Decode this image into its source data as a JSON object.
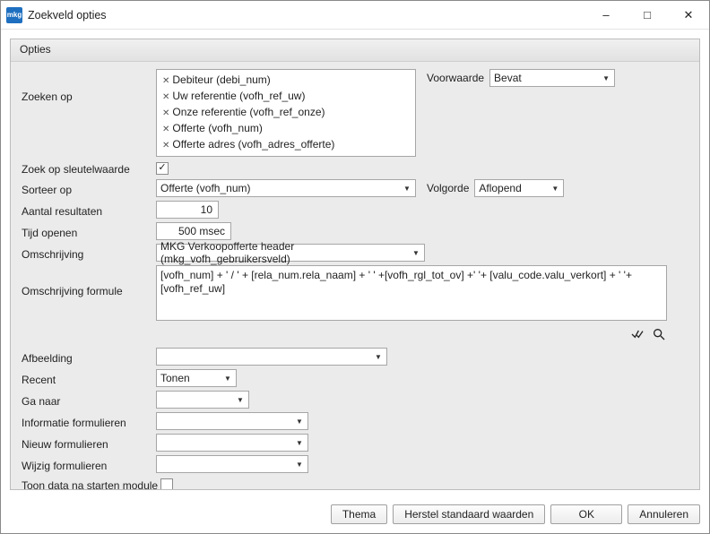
{
  "window": {
    "title": "Zoekveld opties",
    "icon_text": "mkg"
  },
  "groupbox": {
    "title": "Opties"
  },
  "labels": {
    "zoeken_op": "Zoeken op",
    "voorwaarde": "Voorwaarde",
    "zoek_sleutel": "Zoek op sleutelwaarde",
    "sorteer_op": "Sorteer op",
    "volgorde": "Volgorde",
    "aantal_resultaten": "Aantal resultaten",
    "tijd_openen": "Tijd openen",
    "omschrijving": "Omschrijving",
    "omschrijving_formule": "Omschrijving formule",
    "afbeelding": "Afbeelding",
    "recent": "Recent",
    "ga_naar": "Ga naar",
    "informatie_form": "Informatie formulieren",
    "nieuw_form": "Nieuw formulieren",
    "wijzig_form": "Wijzig formulieren",
    "toon_data": "Toon data na starten module"
  },
  "zoeken_op_tags": [
    "Debiteur (debi_num)",
    "Uw referentie (vofh_ref_uw)",
    "Onze referentie (vofh_ref_onze)",
    "Offerte (vofh_num)",
    "Offerte adres (vofh_adres_offerte)"
  ],
  "fields": {
    "voorwaarde": "Bevat",
    "zoek_sleutel_checked": "✓",
    "sorteer_op": "Offerte (vofh_num)",
    "volgorde": "Aflopend",
    "aantal_resultaten": "10",
    "tijd_openen": "500 msec",
    "omschrijving": "MKG Verkoopofferte header (mkg_vofh_gebruikersveld)",
    "omschrijving_formule": "[vofh_num] + ' / ' + [rela_num.rela_naam] + ' ' +[vofh_rgl_tot_ov] +' '+ [valu_code.valu_verkort] + ' '+[vofh_ref_uw]",
    "afbeelding": "",
    "recent": "Tonen",
    "ga_naar": "",
    "informatie_form": "",
    "nieuw_form": "",
    "wijzig_form": "",
    "toon_data_checked": ""
  },
  "buttons": {
    "thema": "Thema",
    "herstel": "Herstel standaard waarden",
    "ok": "OK",
    "annuleren": "Annuleren"
  }
}
